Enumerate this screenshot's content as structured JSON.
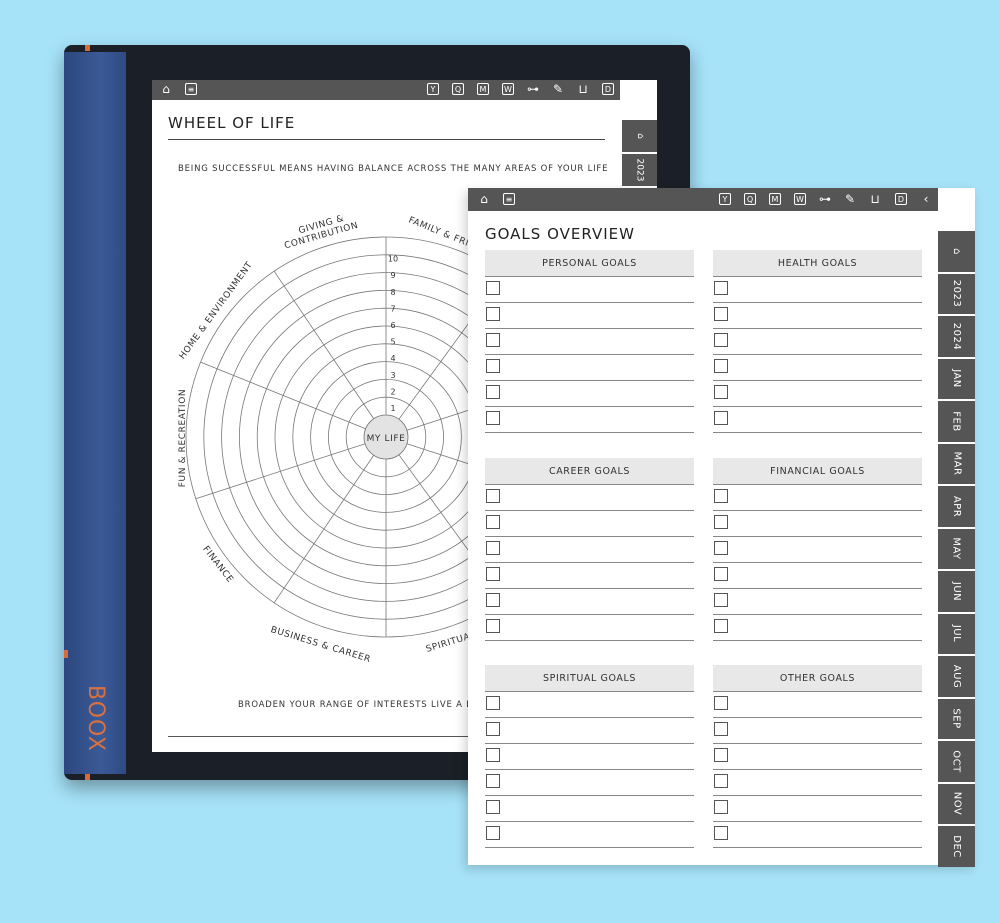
{
  "device": {
    "brand": "BOOX"
  },
  "topbar_icons": [
    "home-icon",
    "notes-icon",
    "Y",
    "Q",
    "M",
    "W",
    "dumbbell-icon",
    "tools-icon",
    "basket-icon",
    "D"
  ],
  "back_page": {
    "title": "WHEEL OF LIFE",
    "subtitle": "BEING SUCCESSFUL MEANS HAVING BALANCE ACROSS THE MANY AREAS OF YOUR LIFE",
    "footer": "BROADEN YOUR RANGE OF INTERESTS LIVE A BA",
    "tabs": [
      "2023"
    ],
    "wheel": {
      "center": "MY LIFE",
      "scale": [
        "1",
        "2",
        "3",
        "4",
        "5",
        "6",
        "7",
        "8",
        "9",
        "10"
      ],
      "segments": [
        "GIVING &",
        "CONTRIBUTION",
        "FAMILY & FRI",
        "HOME & ENVIRONMENT",
        "FUN & RECREATION",
        "FINANCE",
        "BUSINESS & CAREER",
        "SPIRITUA"
      ]
    }
  },
  "front_page": {
    "title": "GOALS OVERVIEW",
    "tabs": [
      "2023",
      "2024",
      "JAN",
      "FEB",
      "MAR",
      "APR",
      "MAY",
      "JUN",
      "JUL",
      "AUG",
      "SEP",
      "OCT",
      "NOV",
      "DEC"
    ],
    "sections": [
      {
        "name": "PERSONAL GOALS"
      },
      {
        "name": "HEALTH GOALS"
      },
      {
        "name": "CAREER GOALS"
      },
      {
        "name": "FINANCIAL GOALS"
      },
      {
        "name": "SPIRITUAL GOALS"
      },
      {
        "name": "OTHER GOALS"
      }
    ]
  },
  "colors": {
    "background": "#a6e2f8",
    "bar": "#555555",
    "spine": "#3a5a97",
    "accent": "#d96a3b"
  }
}
